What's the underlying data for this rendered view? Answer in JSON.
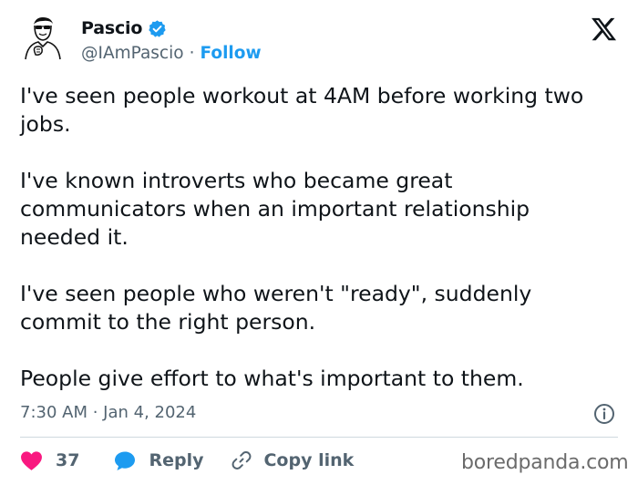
{
  "author": {
    "display_name": "Pascio",
    "handle": "@IAmPascio",
    "separator": "·",
    "follow_label": "Follow",
    "verified_color": "#1d9bf0"
  },
  "tweet": {
    "paragraphs": [
      "I've seen people workout at 4AM before working two jobs.",
      "I've known introverts who became great communicators when an important relationship needed it.",
      "I've seen people who weren't \"ready\", suddenly commit to the right person.",
      "People give effort to what's important to them."
    ],
    "timestamp": "7:30 AM · Jan 4, 2024"
  },
  "actions": {
    "like_count": "37",
    "reply_label": "Reply",
    "copy_link_label": "Copy link",
    "like_color": "#f91880",
    "reply_color": "#1d9bf0"
  },
  "icons": {
    "logo": "x-logo-icon",
    "info": "info-icon",
    "heart": "heart-icon",
    "reply": "speech-bubble-icon",
    "link": "link-icon",
    "verified": "verified-badge-icon"
  },
  "watermark": "boredpanda.com"
}
